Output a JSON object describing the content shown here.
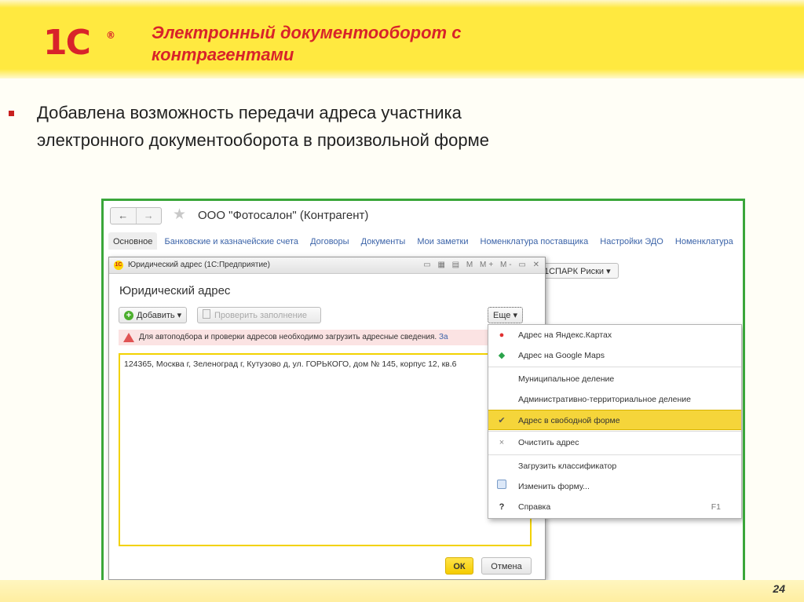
{
  "slide": {
    "logo_text": "1С",
    "logo_reg": "®",
    "title": "Электронный документооборот с контрагентами",
    "bullet": "Добавлена возможность передачи адреса участника электронного документооборота в произвольной форме",
    "page_number": "24"
  },
  "window": {
    "nav_back": "←",
    "nav_forward": "→",
    "star_icon": "★",
    "title": "ООО \"Фотосалон\" (Контрагент)",
    "tabs": [
      {
        "label": "Основное"
      },
      {
        "label": "Банковские и казначейские счета"
      },
      {
        "label": "Договоры"
      },
      {
        "label": "Документы"
      },
      {
        "label": "Мои заметки"
      },
      {
        "label": "Номенклатура поставщика"
      },
      {
        "label": "Настройки ЭДО"
      },
      {
        "label": "Номенклатура"
      }
    ],
    "ispark_label": "1СПАРК Риски"
  },
  "dialog": {
    "title": "Юридический адрес  (1С:Предприятие)",
    "tools": "▭ ▦ ▤ M M+ M- ▭ ✕",
    "heading": "Юридический адрес",
    "add_button": "Добавить",
    "check_button": "Проверить заполнение",
    "more_button": "Еще",
    "warning_text": "Для автоподбора и проверки адресов необходимо загрузить адресные сведения.",
    "warning_link": "За",
    "address_value": "124365, Москва г, Зеленоград г, Кутузово д, ул. ГОРЬКОГО, дом № 145, корпус 12, кв.6",
    "ok_button": "ОК",
    "cancel_button": "Отмена"
  },
  "menu": {
    "items": [
      {
        "icon": "map-pin-icon",
        "label": "Адрес на Яндекс.Картах",
        "key": ""
      },
      {
        "icon": "google-maps-icon",
        "label": "Адрес на Google Maps",
        "key": ""
      },
      {
        "icon": "",
        "label": "Муниципальное деление",
        "key": ""
      },
      {
        "icon": "",
        "label": "Административно-территориальное деление",
        "key": ""
      },
      {
        "icon": "checkmark-icon",
        "label": "Адрес в свободной форме",
        "key": "",
        "selected": true
      },
      {
        "icon": "close-icon",
        "label": "Очистить адрес",
        "key": ""
      },
      {
        "icon": "",
        "label": "Загрузить классификатор",
        "key": ""
      },
      {
        "icon": "form-icon",
        "label": "Изменить форму...",
        "key": ""
      },
      {
        "icon": "help-icon",
        "label": "Справка",
        "key": "F1"
      }
    ]
  },
  "colors": {
    "brand_red": "#d8232a",
    "header_yellow": "#ffe940",
    "frame_green": "#3aa63a",
    "highlight_yellow": "#f5d53a"
  }
}
